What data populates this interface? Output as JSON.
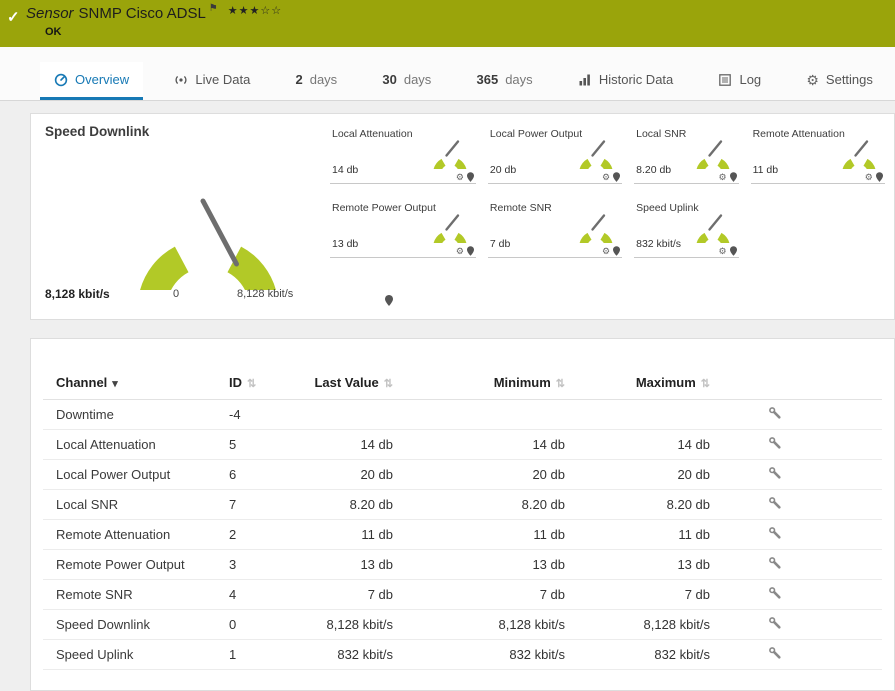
{
  "colors": {
    "header_bg": "#9aa40b",
    "accent_blue": "#1779b5",
    "gauge_green": "#b2c927"
  },
  "icons": {
    "check": "✓",
    "flag": "⚑",
    "gear": "⚙",
    "sort_desc": "▾",
    "sort_both": "⇅"
  },
  "header": {
    "title_prefix": "Sensor",
    "title": "SNMP Cisco ADSL",
    "stars_filled": "★★★",
    "stars_empty": "☆☆",
    "status": "OK"
  },
  "tabs": {
    "overview": {
      "label": "Overview"
    },
    "live_data": {
      "label": "Live Data"
    },
    "days2": {
      "number": "2",
      "unit": "days"
    },
    "days30": {
      "number": "30",
      "unit": "days"
    },
    "days365": {
      "number": "365",
      "unit": "days"
    },
    "historic": {
      "label": "Historic Data"
    },
    "log": {
      "label": "Log"
    },
    "settings": {
      "label": "Settings"
    }
  },
  "gauge_panel": {
    "main": {
      "label": "Speed Downlink",
      "value": "8,128 kbit/s",
      "scale_min": "0",
      "scale_max": "8,128 kbit/s"
    },
    "small": [
      {
        "label": "Local Attenuation",
        "value": "14 db"
      },
      {
        "label": "Local Power Output",
        "value": "20 db"
      },
      {
        "label": "Local SNR",
        "value": "8.20 db"
      },
      {
        "label": "Remote Attenuation",
        "value": "11 db"
      },
      {
        "label": "Remote Power Output",
        "value": "13 db"
      },
      {
        "label": "Remote SNR",
        "value": "7 db"
      },
      {
        "label": "Speed Uplink",
        "value": "832 kbit/s"
      }
    ]
  },
  "table": {
    "headers": {
      "channel": "Channel",
      "id": "ID",
      "last_value": "Last Value",
      "minimum": "Minimum",
      "maximum": "Maximum"
    },
    "rows": [
      {
        "channel": "Downtime",
        "id": "-4",
        "last_value": "",
        "minimum": "",
        "maximum": ""
      },
      {
        "channel": "Local Attenuation",
        "id": "5",
        "last_value": "14 db",
        "minimum": "14 db",
        "maximum": "14 db"
      },
      {
        "channel": "Local Power Output",
        "id": "6",
        "last_value": "20 db",
        "minimum": "20 db",
        "maximum": "20 db"
      },
      {
        "channel": "Local SNR",
        "id": "7",
        "last_value": "8.20 db",
        "minimum": "8.20 db",
        "maximum": "8.20 db"
      },
      {
        "channel": "Remote Attenuation",
        "id": "2",
        "last_value": "11 db",
        "minimum": "11 db",
        "maximum": "11 db"
      },
      {
        "channel": "Remote Power Output",
        "id": "3",
        "last_value": "13 db",
        "minimum": "13 db",
        "maximum": "13 db"
      },
      {
        "channel": "Remote SNR",
        "id": "4",
        "last_value": "7 db",
        "minimum": "7 db",
        "maximum": "7 db"
      },
      {
        "channel": "Speed Downlink",
        "id": "0",
        "last_value": "8,128 kbit/s",
        "minimum": "8,128 kbit/s",
        "maximum": "8,128 kbit/s"
      },
      {
        "channel": "Speed Uplink",
        "id": "1",
        "last_value": "832 kbit/s",
        "minimum": "832 kbit/s",
        "maximum": "832 kbit/s"
      }
    ]
  }
}
